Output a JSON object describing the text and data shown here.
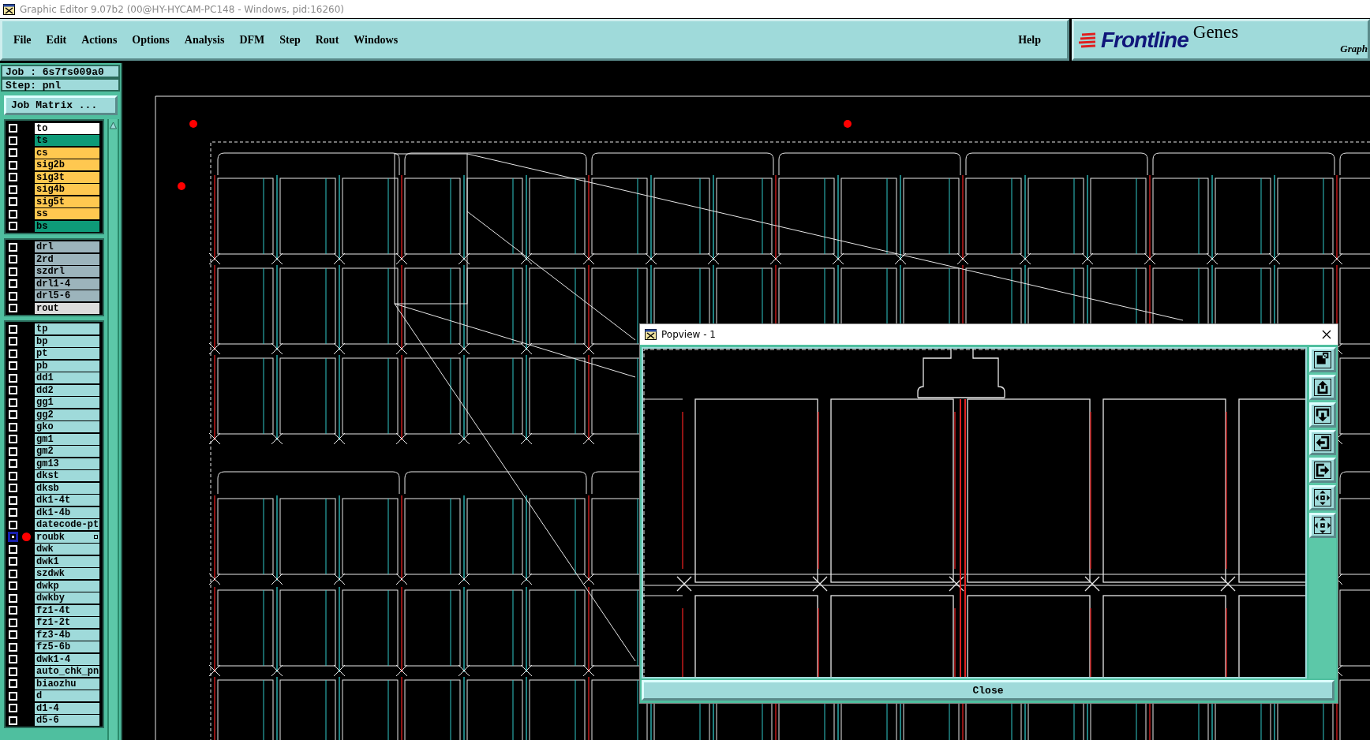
{
  "window": {
    "title": "Graphic Editor 9.07b2 (00@HY-HYCAM-PC148 - Windows, pid:16260)"
  },
  "menu": [
    "File",
    "Edit",
    "Actions",
    "Options",
    "Analysis",
    "DFM",
    "Step",
    "Rout",
    "Windows"
  ],
  "help": "Help",
  "logo": {
    "brand": "Frontline",
    "product": "Genes",
    "tagline": "Graph"
  },
  "job": {
    "job_line": "Job : 6s7fs009a0",
    "step_line": "Step: pnl",
    "matrix_button": "Job Matrix ..."
  },
  "layer_groups": [
    {
      "layers": [
        {
          "name": "to",
          "color": "#ffffff",
          "selected": false,
          "marked": false
        },
        {
          "name": "ts",
          "color": "#0e9a78",
          "selected": false,
          "marked": false
        },
        {
          "name": "cs",
          "color": "#ffc850",
          "selected": false,
          "marked": false
        },
        {
          "name": "sig2b",
          "color": "#ffc850",
          "selected": false,
          "marked": false
        },
        {
          "name": "sig3t",
          "color": "#ffc850",
          "selected": false,
          "marked": false
        },
        {
          "name": "sig4b",
          "color": "#ffc850",
          "selected": false,
          "marked": false
        },
        {
          "name": "sig5t",
          "color": "#ffc850",
          "selected": false,
          "marked": false
        },
        {
          "name": "ss",
          "color": "#ffc850",
          "selected": false,
          "marked": false
        },
        {
          "name": "bs",
          "color": "#0e9a78",
          "selected": false,
          "marked": false
        }
      ]
    },
    {
      "layers": [
        {
          "name": "drl",
          "color": "#9cb4bc",
          "selected": false,
          "marked": false
        },
        {
          "name": "2rd",
          "color": "#9cb4bc",
          "selected": false,
          "marked": false
        },
        {
          "name": "szdrl",
          "color": "#9cb4bc",
          "selected": false,
          "marked": false
        },
        {
          "name": "drl1-4",
          "color": "#9cb4bc",
          "selected": false,
          "marked": false
        },
        {
          "name": "drl5-6",
          "color": "#9cb4bc",
          "selected": false,
          "marked": false
        },
        {
          "name": "rout",
          "color": "#dcdcdc",
          "selected": false,
          "marked": false
        }
      ]
    },
    {
      "layers": [
        {
          "name": "tp",
          "color": "#9fdada",
          "selected": false,
          "marked": false
        },
        {
          "name": "bp",
          "color": "#9fdada",
          "selected": false,
          "marked": false
        },
        {
          "name": "pt",
          "color": "#9fdada",
          "selected": false,
          "marked": false
        },
        {
          "name": "pb",
          "color": "#9fdada",
          "selected": false,
          "marked": false
        },
        {
          "name": "dd1",
          "color": "#9fdada",
          "selected": false,
          "marked": false
        },
        {
          "name": "dd2",
          "color": "#9fdada",
          "selected": false,
          "marked": false
        },
        {
          "name": "gg1",
          "color": "#9fdada",
          "selected": false,
          "marked": false
        },
        {
          "name": "gg2",
          "color": "#9fdada",
          "selected": false,
          "marked": false
        },
        {
          "name": "gko",
          "color": "#9fdada",
          "selected": false,
          "marked": false
        },
        {
          "name": "gm1",
          "color": "#9fdada",
          "selected": false,
          "marked": false
        },
        {
          "name": "gm2",
          "color": "#9fdada",
          "selected": false,
          "marked": false
        },
        {
          "name": "gm13",
          "color": "#9fdada",
          "selected": false,
          "marked": false
        },
        {
          "name": "dkst",
          "color": "#9fdada",
          "selected": false,
          "marked": false
        },
        {
          "name": "dksb",
          "color": "#9fdada",
          "selected": false,
          "marked": false
        },
        {
          "name": "dk1-4t",
          "color": "#9fdada",
          "selected": false,
          "marked": false
        },
        {
          "name": "dk1-4b",
          "color": "#9fdada",
          "selected": false,
          "marked": false
        },
        {
          "name": "datecode-pt",
          "color": "#9fdada",
          "selected": false,
          "marked": false
        },
        {
          "name": "roubk",
          "color": "#9fdada",
          "selected": true,
          "marked": true
        },
        {
          "name": "dwk",
          "color": "#9fdada",
          "selected": false,
          "marked": false
        },
        {
          "name": "dwk1",
          "color": "#9fdada",
          "selected": false,
          "marked": false
        },
        {
          "name": "szdwk",
          "color": "#9fdada",
          "selected": false,
          "marked": false
        },
        {
          "name": "dwkp",
          "color": "#9fdada",
          "selected": false,
          "marked": false
        },
        {
          "name": "dwkby",
          "color": "#9fdada",
          "selected": false,
          "marked": false
        },
        {
          "name": "fz1-4t",
          "color": "#9fdada",
          "selected": false,
          "marked": false
        },
        {
          "name": "fz1-2t",
          "color": "#9fdada",
          "selected": false,
          "marked": false
        },
        {
          "name": "fz3-4b",
          "color": "#9fdada",
          "selected": false,
          "marked": false
        },
        {
          "name": "fz5-6b",
          "color": "#9fdada",
          "selected": false,
          "marked": false
        },
        {
          "name": "dwk1-4",
          "color": "#9fdada",
          "selected": false,
          "marked": false
        },
        {
          "name": "auto_chk_pn",
          "color": "#9fdada",
          "selected": false,
          "marked": false
        },
        {
          "name": "biaozhu",
          "color": "#9fdada",
          "selected": false,
          "marked": false
        },
        {
          "name": "d",
          "color": "#9fdada",
          "selected": false,
          "marked": false
        },
        {
          "name": "d1-4",
          "color": "#9fdada",
          "selected": false,
          "marked": false
        },
        {
          "name": "d5-6",
          "color": "#9fdada",
          "selected": false,
          "marked": false
        }
      ]
    }
  ],
  "popview": {
    "title": "Popview - 1",
    "close_button": "Close"
  }
}
